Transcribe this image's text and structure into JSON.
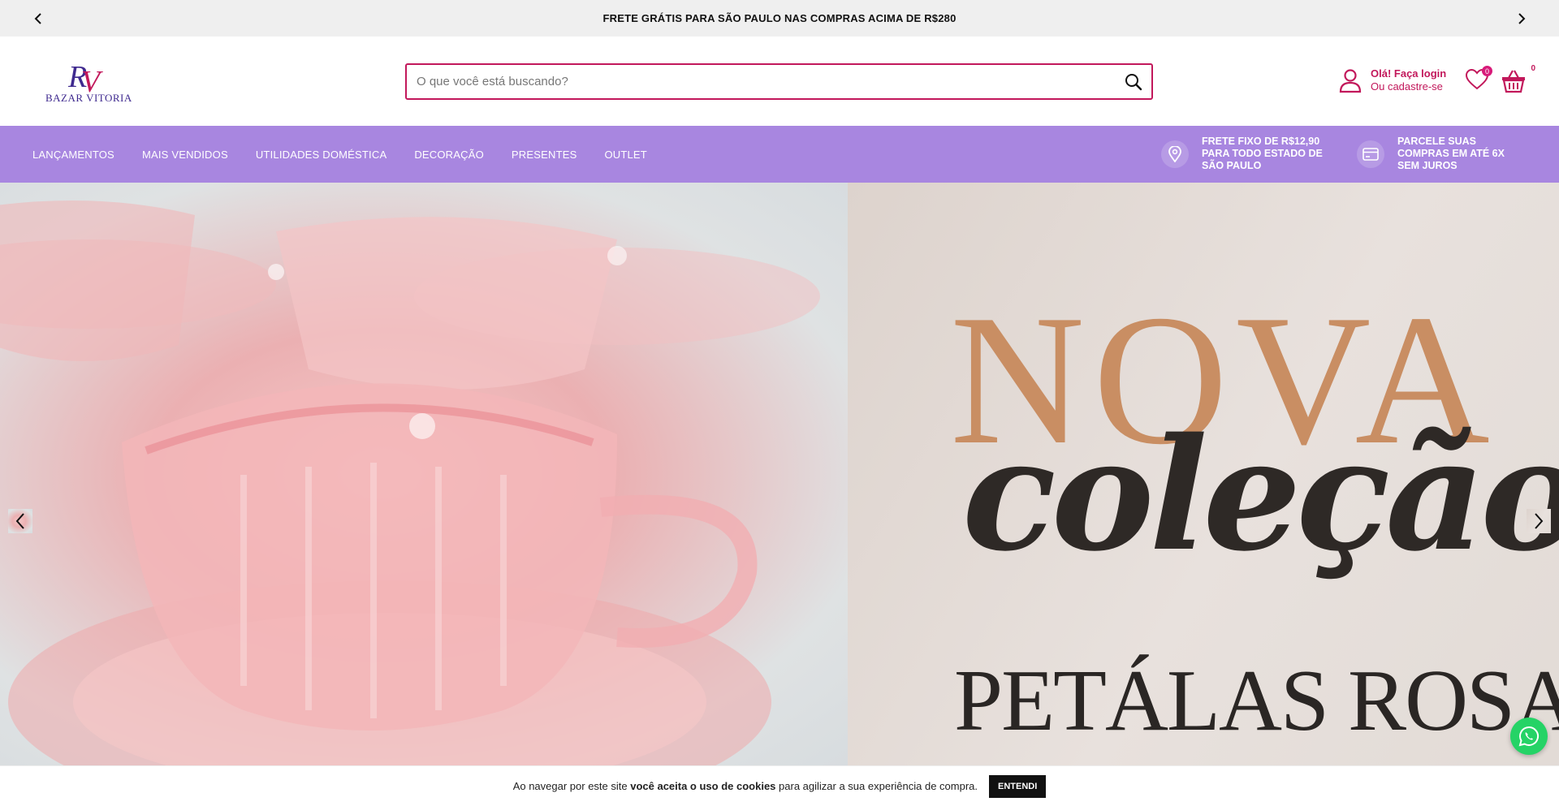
{
  "announcement": {
    "text": "FRETE GRÁTIS PARA SÃO PAULO NAS COMPRAS ACIMA DE R$280"
  },
  "header": {
    "logo_text": "BAZAR VITORIA",
    "search": {
      "placeholder": "O que você está buscando?",
      "value": ""
    },
    "account": {
      "login": "Olá! Faça login",
      "signup": "Ou cadastre-se"
    },
    "wishlist_count": "0",
    "cart_count": "0"
  },
  "nav": {
    "items": [
      {
        "label": "LANÇAMENTOS"
      },
      {
        "label": "MAIS VENDIDOS"
      },
      {
        "label": "UTILIDADES DOMÉSTICA"
      },
      {
        "label": "DECORAÇÃO"
      },
      {
        "label": "PRESENTES"
      },
      {
        "label": "OUTLET"
      }
    ],
    "perks": [
      {
        "line1": "FRETE FIXO DE R$12,90",
        "line2": "PARA TODO ESTADO DE",
        "line3": "SÃO PAULO",
        "icon": "location-pin-icon"
      },
      {
        "line1": "PARCELE SUAS",
        "line2": "COMPRAS EM ATÉ 6X",
        "line3": "SEM JUROS",
        "icon": "credit-card-icon"
      }
    ]
  },
  "hero": {
    "headline": "NOVA",
    "script": "coleção",
    "subline": "PETÁLAS ROSA"
  },
  "cookie": {
    "text_before": "Ao navegar por este site ",
    "text_bold": "você aceita o uso de cookies",
    "text_after": " para agilizar a sua experiência de compra.",
    "button": "ENTENDI"
  },
  "colors": {
    "accent": "#c2185b",
    "nav_bg": "#a886e0",
    "topbar_bg": "#efefef",
    "whatsapp": "#25d366"
  }
}
